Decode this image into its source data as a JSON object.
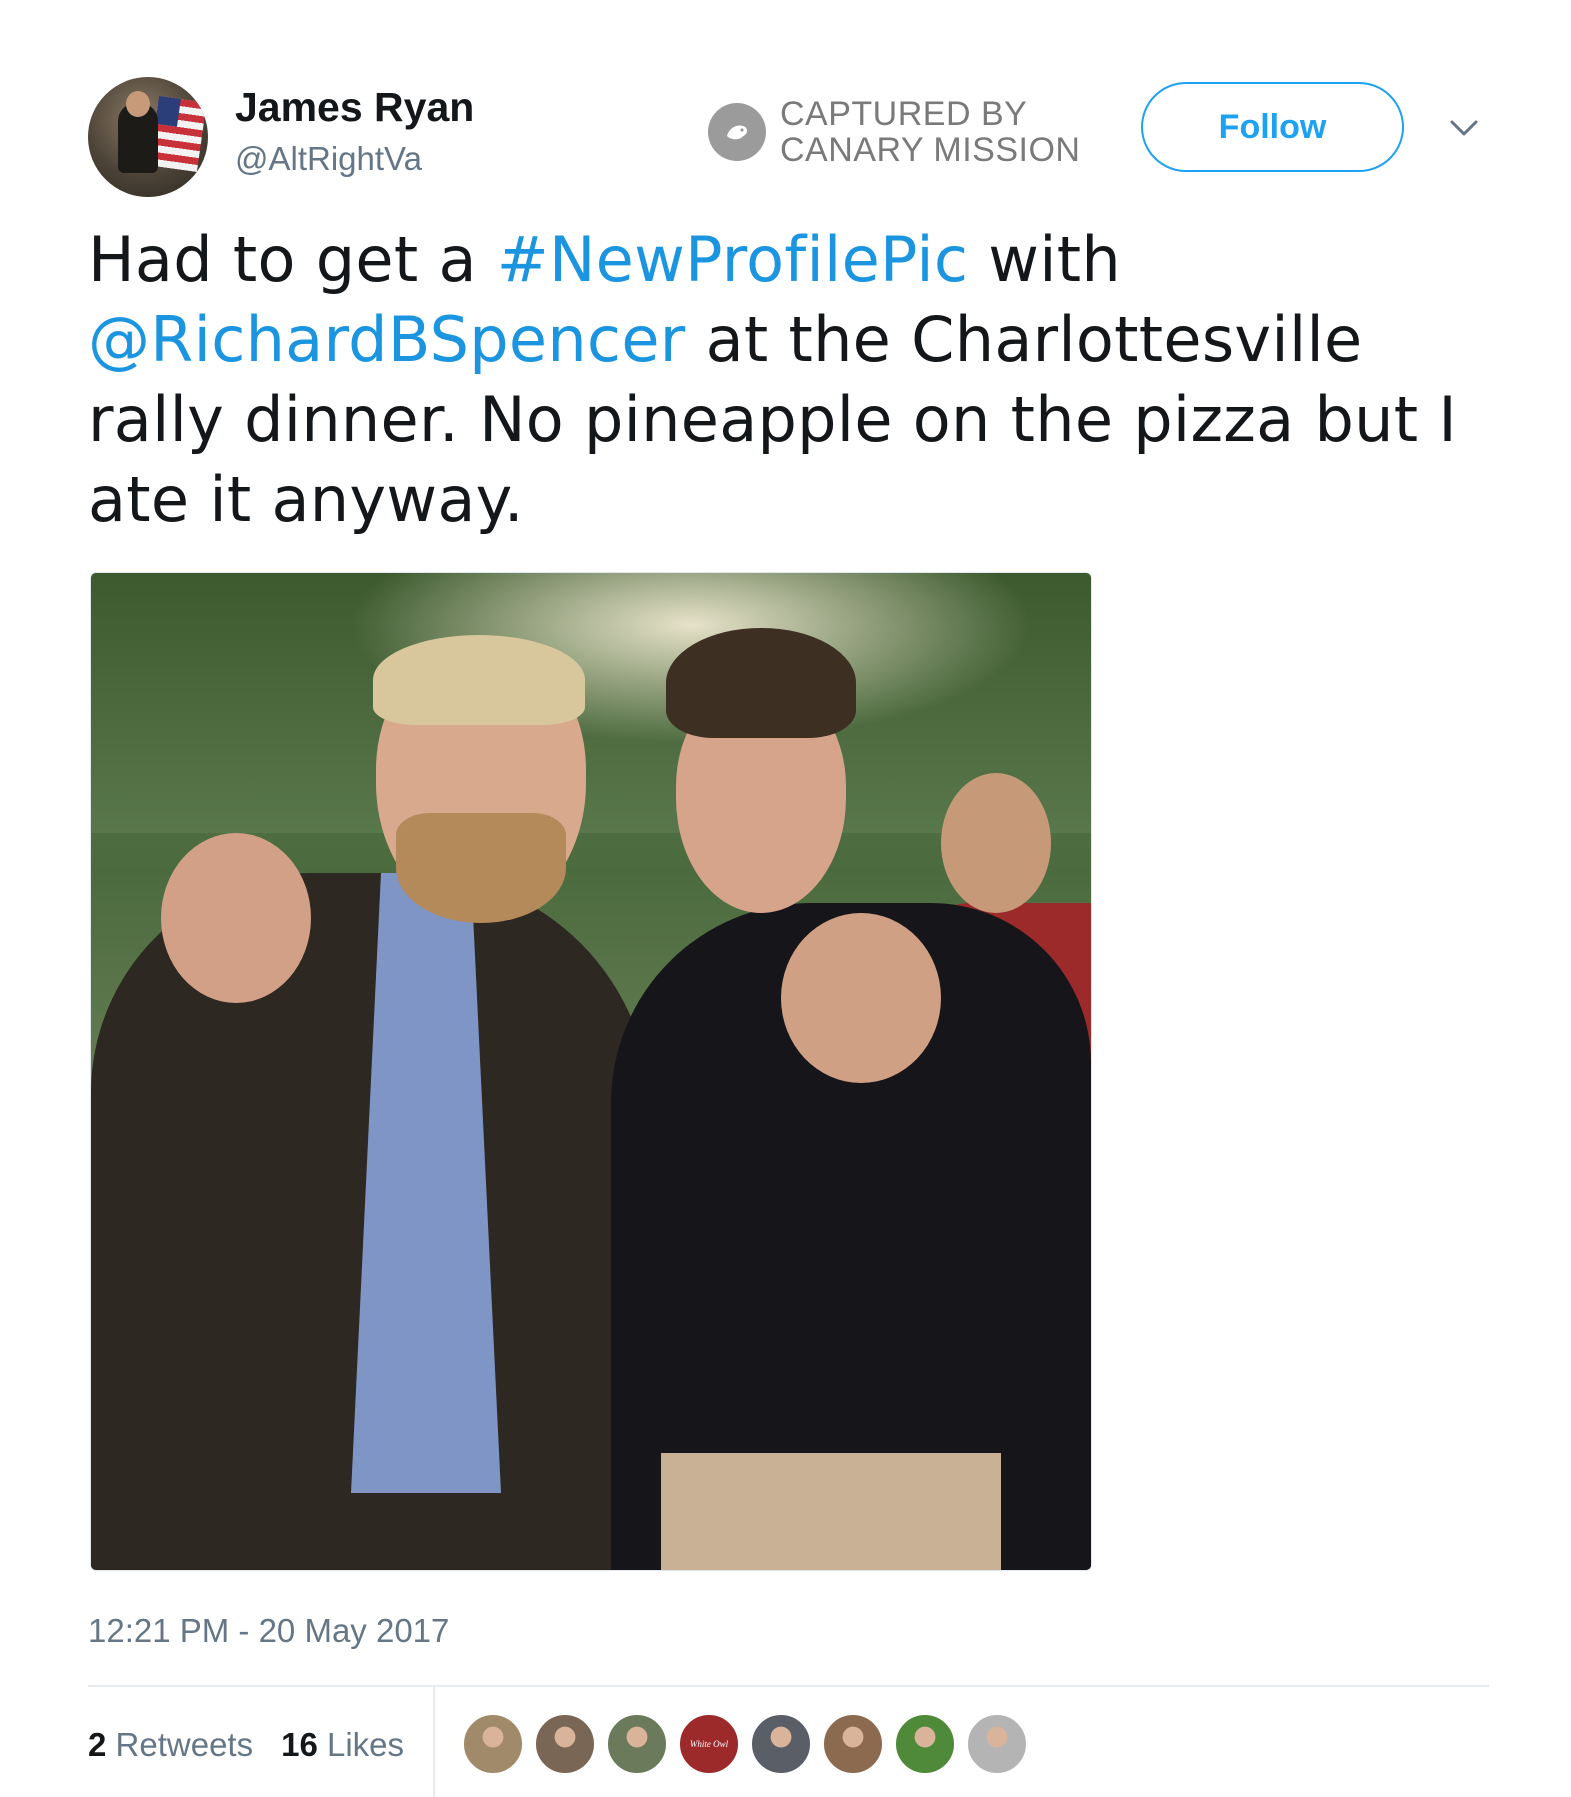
{
  "user": {
    "name": "James Ryan",
    "handle": "@AltRightVa"
  },
  "stamp": {
    "line1": "CAPTURED BY",
    "line2": "CANARY MISSION",
    "icon": "canary-bird-icon"
  },
  "follow_label": "Follow",
  "tweet": {
    "part1": "Had to get a ",
    "hashtag": "#NewProfilePic",
    "part2": " with ",
    "mention": "@RichardBSpencer",
    "part3": " at the Charlottesville rally dinner. No pineapple on the pizza but I ate it anyway."
  },
  "timestamp": "12:21 PM - 20 May 2017",
  "stats": {
    "retweets_count": "2",
    "retweets_label": "Retweets",
    "likes_count": "16",
    "likes_label": "Likes"
  },
  "likers": [
    {
      "color": "#a08a6a"
    },
    {
      "color": "#7a6654"
    },
    {
      "color": "#6b7a5a"
    },
    {
      "color": "#9c2a2a",
      "text": "White Owl"
    },
    {
      "color": "#5a5e66"
    },
    {
      "color": "#8c6a50"
    },
    {
      "color": "#4f8a3a"
    },
    {
      "color": "#b4b4b4"
    }
  ],
  "colors": {
    "link": "#1b95e0",
    "accent": "#1da1f2",
    "muted": "#657786"
  }
}
